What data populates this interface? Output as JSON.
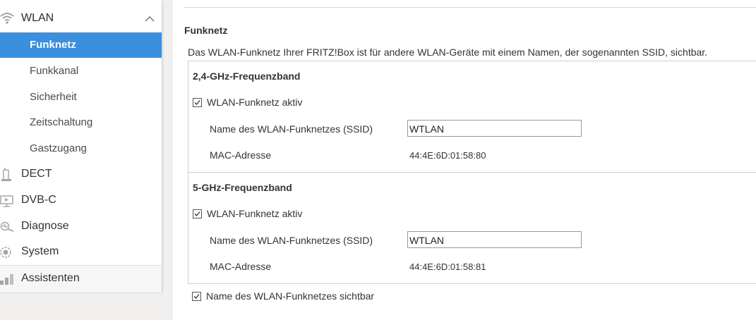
{
  "sidebar": {
    "wlan": {
      "label": "WLAN",
      "icon": "wifi-icon",
      "expanded_icon": "chevron-up-icon"
    },
    "sub_items": [
      {
        "label": "Funknetz",
        "active": true
      },
      {
        "label": "Funkkanal",
        "active": false
      },
      {
        "label": "Sicherheit",
        "active": false
      },
      {
        "label": "Zeitschaltung",
        "active": false
      },
      {
        "label": "Gastzugang",
        "active": false
      }
    ],
    "main_items": [
      {
        "label": "DECT",
        "icon": "phone-icon"
      },
      {
        "label": "DVB-C",
        "icon": "tv-icon"
      },
      {
        "label": "Diagnose",
        "icon": "diagnose-icon"
      },
      {
        "label": "System",
        "icon": "system-icon"
      }
    ],
    "assistant": {
      "label": "Assistenten",
      "icon": "assistant-icon"
    }
  },
  "content": {
    "title": "Funknetz",
    "description": "Das WLAN-Funknetz Ihrer FRITZ!Box ist für andere WLAN-Geräte mit einem Namen, der sogenannten SSID, sichtbar.",
    "bands": [
      {
        "title": "2,4-GHz-Frequenzband",
        "active_label": "WLAN-Funknetz aktiv",
        "active_checked": true,
        "ssid_label": "Name des WLAN-Funknetzes (SSID)",
        "ssid_value": "WTLAN",
        "mac_label": "MAC-Adresse",
        "mac_value": "44:4E:6D:01:58:80"
      },
      {
        "title": "5-GHz-Frequenzband",
        "active_label": "WLAN-Funknetz aktiv",
        "active_checked": true,
        "ssid_label": "Name des WLAN-Funknetzes (SSID)",
        "ssid_value": "WTLAN",
        "mac_label": "MAC-Adresse",
        "mac_value": "44:4E:6D:01:58:81"
      }
    ],
    "visible_label": "Name des WLAN-Funknetzes sichtbar",
    "visible_checked": true
  },
  "colors": {
    "accent": "#3a8fde",
    "sidebar_bg": "#ffffff",
    "page_bg": "#f2f0ee"
  }
}
